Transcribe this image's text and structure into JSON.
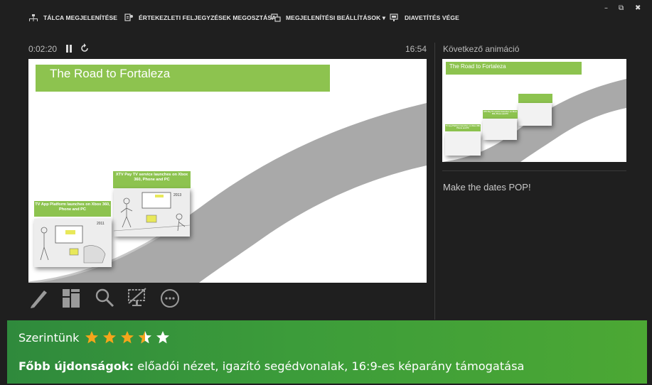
{
  "toolbar": {
    "taskbar_label": "TÁLCA MEGJELENÍTÉSE",
    "share_notes_label": "ÉRTEKEZLETI FELJEGYZÉSEK MEGOSZTÁSA",
    "display_settings_label": "MEGJELENÍTÉSI BEÁLLÍTÁSOK ▾",
    "end_show_label": "DIAVETÍTÉS VÉGE"
  },
  "window": {
    "minimize": "–",
    "restore": "⧉",
    "close": "✖"
  },
  "presenter": {
    "elapsed": "0:02:20",
    "clock": "16:54",
    "next_label": "Következő animáció",
    "notes": "Make the dates POP!"
  },
  "slide": {
    "title": "The Road to Fortaleza",
    "callout_1": "XTV Pay TV service launches on Xbox 360, Phone and PC",
    "callout_2": "TV App Platform launches on Xbox 360, Phone and PC",
    "year_1": "2013",
    "year_2": "2011"
  },
  "icons": [
    "pause-icon",
    "reset-icon",
    "pen-icon",
    "slides-grid-icon",
    "zoom-icon",
    "black-screen-icon",
    "more-options-icon"
  ],
  "review": {
    "rating_label": "Szerintünk",
    "rating": 3.5,
    "rating_max": 5,
    "features_bold": "Főbb újdonságok:",
    "features_text": " előadói nézet, igazító segédvonalak, 16:9-es képarány támogatása"
  },
  "colors": {
    "accent_green": "#8dc34f",
    "star": "#f5a51b",
    "review_bg": "#3c9c3a"
  }
}
